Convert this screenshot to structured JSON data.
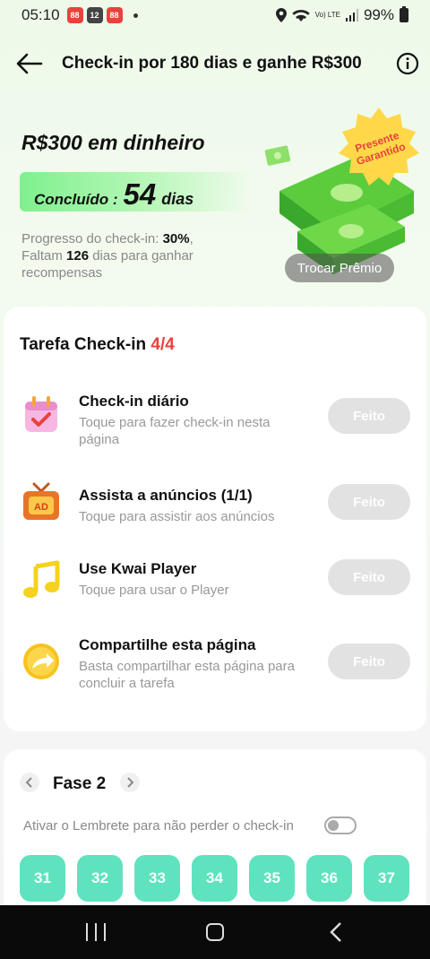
{
  "status": {
    "time": "05:10",
    "app_badges": [
      "88",
      "12",
      "88"
    ],
    "network": "Vo) LTE",
    "battery": "99%"
  },
  "header": {
    "title": "Check-in por 180 dias e ganhe R$300"
  },
  "hero": {
    "title": "R$300 em dinheiro",
    "done_label": "Concluído :",
    "done_value": "54",
    "done_unit": "dias",
    "progress_prefix": "Progresso do check-in: ",
    "progress_percent": "30%",
    "progress_sep": ",",
    "remaining_prefix": "Faltam ",
    "remaining_days": "126",
    "remaining_suffix": " dias para ganhar recompensas",
    "gift_tag": "Presente Garantido",
    "swap_button": "Trocar Prêmio"
  },
  "task_card": {
    "title": "Tarefa Check-in",
    "count": "4/4",
    "tasks": [
      {
        "name": "Check-in diário",
        "desc": "Toque para fazer check-in nesta página",
        "button": "Feito",
        "icon": "calendar-check-icon"
      },
      {
        "name": "Assista a anúncios  (1/1)",
        "desc": "Toque para assistir aos anúncios",
        "button": "Feito",
        "icon": "ad-tv-icon"
      },
      {
        "name": "Use Kwai Player",
        "desc": "Toque para usar o Player",
        "button": "Feito",
        "icon": "music-note-icon"
      },
      {
        "name": "Compartilhe esta página",
        "desc": "Basta compartilhar esta página para concluir a tarefa",
        "button": "Feito",
        "icon": "share-arrow-icon"
      }
    ]
  },
  "phase": {
    "title": "Fase 2",
    "reminder": "Ativar o Lembrete para não perder o check-in",
    "reminder_on": false,
    "days": [
      "31",
      "32",
      "33",
      "34",
      "35",
      "36",
      "37"
    ]
  },
  "colors": {
    "accent_green": "#5ee3be",
    "count_red": "#e8423c",
    "done_grey": "#e2e2e2"
  }
}
